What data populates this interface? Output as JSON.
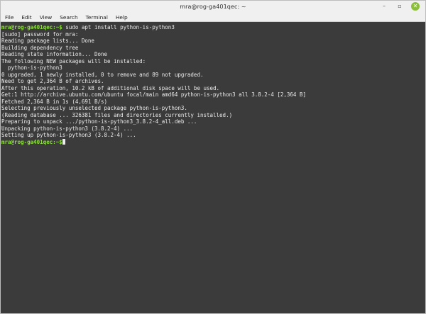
{
  "window": {
    "title": "mra@rog-ga401qec: ~",
    "controls": {
      "minimize": "–",
      "maximize": "▫",
      "close": "✕"
    }
  },
  "menu": {
    "items": [
      "File",
      "Edit",
      "View",
      "Search",
      "Terminal",
      "Help"
    ]
  },
  "terminal": {
    "prompt": "mra@rog-ga401qec:~$",
    "command": " sudo apt install python-is-python3",
    "output": [
      "[sudo] password for mra:",
      "Reading package lists... Done",
      "Building dependency tree",
      "Reading state information... Done",
      "The following NEW packages will be installed:",
      "  python-is-python3",
      "0 upgraded, 1 newly installed, 0 to remove and 89 not upgraded.",
      "Need to get 2,364 B of archives.",
      "After this operation, 10.2 kB of additional disk space will be used.",
      "Get:1 http://archive.ubuntu.com/ubuntu focal/main amd64 python-is-python3 all 3.8.2-4 [2,364 B]",
      "Fetched 2,364 B in 1s (4,691 B/s)",
      "Selecting previously unselected package python-is-python3.",
      "(Reading database ... 326381 files and directories currently installed.)",
      "Preparing to unpack .../python-is-python3_3.8.2-4_all.deb ...",
      "Unpacking python-is-python3 (3.8.2-4) ...",
      "Setting up python-is-python3 (3.8.2-4) ..."
    ],
    "final_prompt": "mra@rog-ga401qec:~$"
  }
}
